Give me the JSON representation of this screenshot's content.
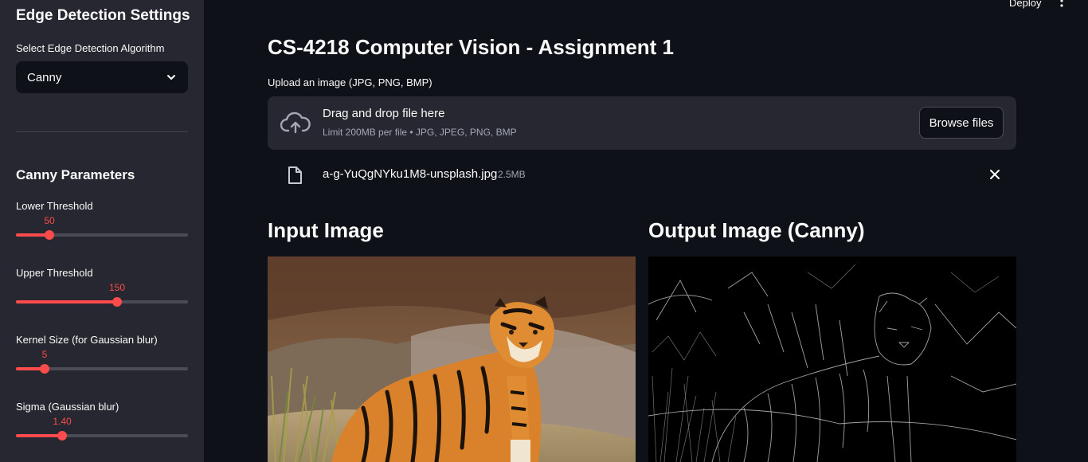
{
  "sidebar": {
    "title": "Edge Detection Settings",
    "algorithm_label": "Select Edge Detection Algorithm",
    "algorithm_value": "Canny",
    "params_title": "Canny Parameters",
    "sliders": [
      {
        "label": "Lower Threshold",
        "value": "50",
        "fraction": 0.196
      },
      {
        "label": "Upper Threshold",
        "value": "150",
        "fraction": 0.59
      },
      {
        "label": "Kernel Size (for Gaussian blur)",
        "value": "5",
        "fraction": 0.167
      },
      {
        "label": "Sigma (Gaussian blur)",
        "value": "1.40",
        "fraction": 0.269
      }
    ]
  },
  "topbar": {
    "deploy_label": "Deploy"
  },
  "main": {
    "title": "CS-4218 Computer Vision - Assignment 1",
    "upload_label": "Upload an image (JPG, PNG, BMP)",
    "dropzone": {
      "main_text": "Drag and drop file here",
      "sub_text": "Limit 200MB per file • JPG, JPEG, PNG, BMP",
      "browse_label": "Browse files"
    },
    "file": {
      "name": "a-g-YuQgNYku1M8-unsplash.jpg",
      "size": "2.5MB"
    },
    "input_title": "Input Image",
    "output_title": "Output Image (Canny)"
  },
  "colors": {
    "accent": "#ff4b4b",
    "sidebar_bg": "#262730",
    "page_bg": "#0e1117"
  }
}
